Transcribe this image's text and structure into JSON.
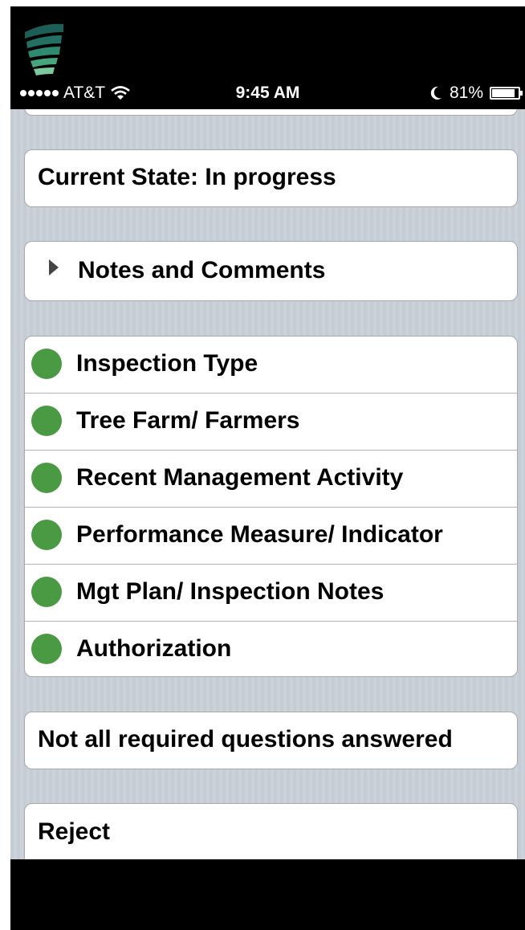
{
  "status_bar": {
    "carrier": "AT&T",
    "time": "9:45 AM",
    "battery": "81%",
    "battery_level": 0.81
  },
  "current_state": "Current State: In progress",
  "notes": {
    "label": "Notes and Comments"
  },
  "sections": [
    {
      "label": "Inspection Type",
      "status_color": "#4a9a44"
    },
    {
      "label": "Tree Farm/ Farmers",
      "status_color": "#4a9a44"
    },
    {
      "label": "Recent Management Activity",
      "status_color": "#4a9a44"
    },
    {
      "label": "Performance Measure/ Indicator",
      "status_color": "#4a9a44"
    },
    {
      "label": "Mgt Plan/ Inspection Notes",
      "status_color": "#4a9a44"
    },
    {
      "label": "Authorization",
      "status_color": "#4a9a44"
    }
  ],
  "submit_status": "Not all required questions answered",
  "reject_label": "Reject",
  "colors": {
    "accent_green": "#4a9a44",
    "logo_teal": "#1b6b5e"
  },
  "icons": [
    "app-logo-icon",
    "wifi-icon",
    "moon-icon",
    "battery-icon",
    "disclosure-arrow-icon",
    "status-dot-icon"
  ]
}
